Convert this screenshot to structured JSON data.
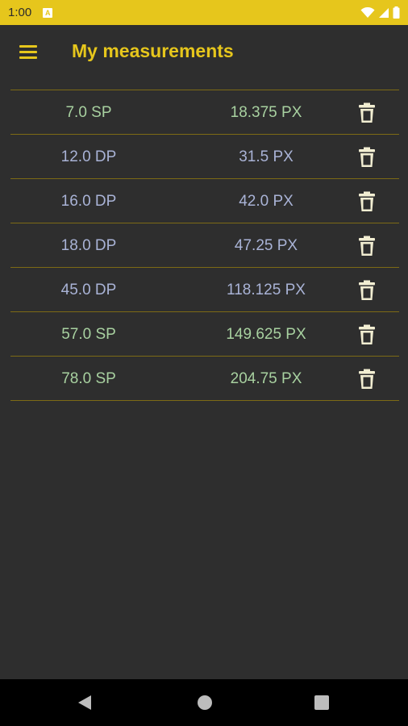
{
  "status_bar": {
    "time": "1:00",
    "notification_icon": "a-box-icon",
    "icons": [
      "wifi-icon",
      "signal-icon",
      "battery-icon"
    ]
  },
  "app_bar": {
    "title": "My measurements",
    "menu_icon": "hamburger-menu-icon",
    "accent_color": "#e6c61c"
  },
  "colors": {
    "sp_text": "#a8d1a0",
    "dp_text": "#a9b3d6",
    "divider": "#7d6a15",
    "background": "#2e2e2e"
  },
  "measurements": [
    {
      "value": "7.0 SP",
      "pixels": "18.375 PX",
      "unit": "SP",
      "delete_icon": "trash-icon"
    },
    {
      "value": "12.0 DP",
      "pixels": "31.5 PX",
      "unit": "DP",
      "delete_icon": "trash-icon"
    },
    {
      "value": "16.0 DP",
      "pixels": "42.0 PX",
      "unit": "DP",
      "delete_icon": "trash-icon"
    },
    {
      "value": "18.0 DP",
      "pixels": "47.25 PX",
      "unit": "DP",
      "delete_icon": "trash-icon"
    },
    {
      "value": "45.0 DP",
      "pixels": "118.125 PX",
      "unit": "DP",
      "delete_icon": "trash-icon"
    },
    {
      "value": "57.0 SP",
      "pixels": "149.625 PX",
      "unit": "SP",
      "delete_icon": "trash-icon"
    },
    {
      "value": "78.0 SP",
      "pixels": "204.75 PX",
      "unit": "SP",
      "delete_icon": "trash-icon"
    }
  ],
  "nav_bar": {
    "buttons": [
      "back-icon",
      "home-icon",
      "recents-icon"
    ]
  }
}
